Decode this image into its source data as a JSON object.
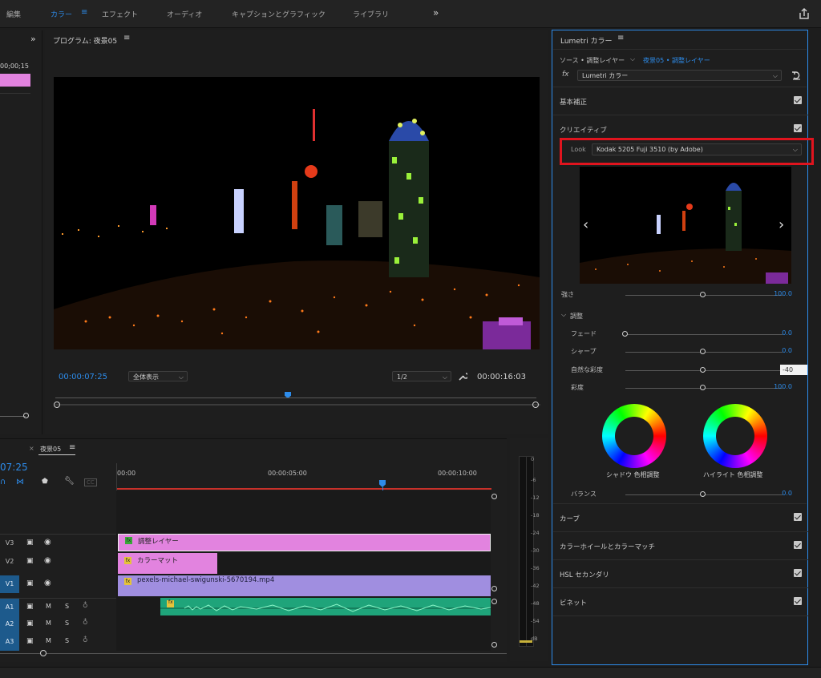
{
  "workspace": {
    "tabs": [
      "編集",
      "カラー",
      "エフェクト",
      "オーディオ",
      "キャプションとグラフィック",
      "ライブラリ"
    ],
    "active": "カラー",
    "more": "»"
  },
  "source_panel": {
    "expand": "»",
    "timecode": "00;00;15"
  },
  "program": {
    "title": "プログラム: 夜景05",
    "timecode": "00:00:07:25",
    "fit": "全体表示",
    "resolution": "1/2",
    "duration": "00:00:16:03",
    "controls": [
      "marker",
      "in-point",
      "out-point",
      "go-to-in",
      "step-back",
      "play",
      "step-forward",
      "go-to-out",
      "lift",
      "extract",
      "export-frame",
      "compare",
      "add"
    ]
  },
  "timeline": {
    "tab": "夜景05",
    "timecode": "07:25",
    "ruler": [
      "00:00",
      "00:00:05:00",
      "00:00:10:00"
    ],
    "playhead_fraction": 0.71,
    "tracks": [
      {
        "id": "V3",
        "type": "video"
      },
      {
        "id": "V2",
        "type": "video"
      },
      {
        "id": "V1",
        "type": "video"
      },
      {
        "id": "A1",
        "type": "audio"
      },
      {
        "id": "A2",
        "type": "audio"
      },
      {
        "id": "A3",
        "type": "audio"
      }
    ],
    "audio_labels": {
      "mute": "M",
      "solo": "S"
    },
    "clips": {
      "v3": "調整レイヤー",
      "v2": "カラーマット",
      "v1": "pexels-michael-swigunski-5670194.mp4",
      "fx": "fx"
    }
  },
  "meter": {
    "scale": [
      "0",
      "-6",
      "-12",
      "-18",
      "-24",
      "-30",
      "-36",
      "-42",
      "-48",
      "-54",
      "dB"
    ]
  },
  "lumetri": {
    "title": "Lumetri カラー",
    "source": "ソース • 調整レイヤー",
    "target": "夜景05 • 調整レイヤー",
    "fx_label": "fx",
    "effect": "Lumetri カラー",
    "sections": {
      "basic": "基本補正",
      "creative": "クリエイティブ",
      "curves": "カーブ",
      "wheels": "カラーホイールとカラーマッチ",
      "hsl": "HSL セカンダリ",
      "vignette": "ビネット"
    },
    "look_label": "Look",
    "look_value": "Kodak 5205 Fuji 3510 (by Adobe)",
    "intensity_label": "強さ",
    "intensity_value": "100.0",
    "adjust_label": "調整",
    "sliders": [
      {
        "label": "フェード",
        "value": "0.0",
        "fraction": 0.0
      },
      {
        "label": "シャープ",
        "value": "0.0",
        "fraction": 0.5
      },
      {
        "label": "自然な彩度",
        "value": "-40",
        "fraction": 0.5
      },
      {
        "label": "彩度",
        "value": "100.0",
        "fraction": 0.5
      }
    ],
    "shadow_label": "シャドウ 色相調整",
    "highlight_label": "ハイライト 色相調整",
    "balance_label": "バランス",
    "balance_value": "0.0",
    "highlight_color": "#e0141e"
  }
}
